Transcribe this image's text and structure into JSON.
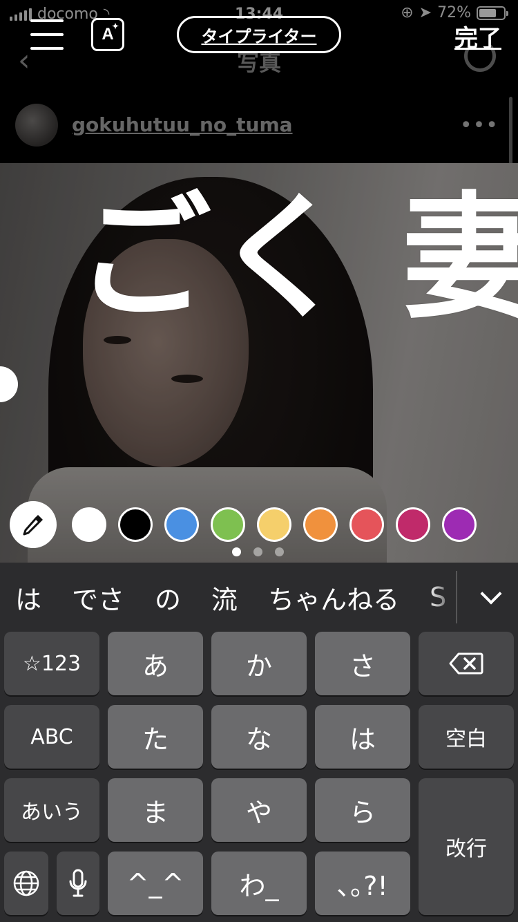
{
  "status_bar": {
    "carrier": "docomo",
    "time": "13:44",
    "battery": "72%",
    "battery_level": 0.72
  },
  "nav": {
    "title": "写真",
    "back_icon": "chevron-left-icon",
    "reload_icon": "reload-icon"
  },
  "editor": {
    "font_style_label": "タイプライター",
    "done_label": "完了",
    "effect_icon_label": "A"
  },
  "post": {
    "username": "gokuhutuu_no_tuma",
    "more": "•••"
  },
  "overlay_text": "ごく 妻",
  "palette": {
    "colors": [
      "#ffffff",
      "#000000",
      "#4a90e2",
      "#7ec050",
      "#f5cf6b",
      "#f0913d",
      "#e5545a",
      "#c02a6a",
      "#9d2bb3"
    ],
    "page_count": 3,
    "active_page": 1
  },
  "keyboard": {
    "candidates": [
      "は",
      "でさ",
      "の",
      "流",
      "ちゃんねる",
      "S"
    ],
    "keys": {
      "num": "☆123",
      "a": "あ",
      "ka": "か",
      "sa": "さ",
      "abc": "ABC",
      "ta": "た",
      "na": "な",
      "ha": "は",
      "space": "空白",
      "aiu": "あいう",
      "ma": "ま",
      "ya": "や",
      "ra": "ら",
      "return": "改行",
      "kaomoji": "^_^",
      "wa": "わ_",
      "punct": "､｡?!"
    }
  }
}
